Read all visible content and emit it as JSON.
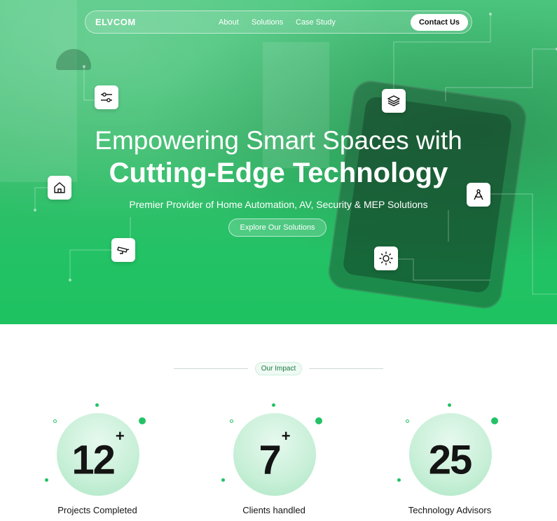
{
  "nav": {
    "logo": "ELVCOM",
    "links": [
      "About",
      "Solutions",
      "Case Study"
    ],
    "contact_label": "Contact Us"
  },
  "hero": {
    "title_line1": "Empowering Smart Spaces with",
    "title_line2": "Cutting-Edge Technology",
    "subtitle": "Premier Provider of Home Automation, AV, Security & MEP Solutions",
    "cta_label": "Explore Our Solutions",
    "floating_icons": [
      "sliders-icon",
      "layers-icon",
      "home-icon",
      "compass-icon",
      "security-camera-icon",
      "sun-icon"
    ]
  },
  "impact": {
    "badge": "Our Impact",
    "stats": [
      {
        "value": "12",
        "suffix": "+",
        "label": "Projects Completed"
      },
      {
        "value": "7",
        "suffix": "+",
        "label": "Clients handled"
      },
      {
        "value": "25",
        "suffix": "",
        "label": "Technology Advisors"
      }
    ]
  },
  "colors": {
    "accent": "#22c265",
    "hero_green": "#3bbd6e",
    "text_dark": "#141414"
  }
}
